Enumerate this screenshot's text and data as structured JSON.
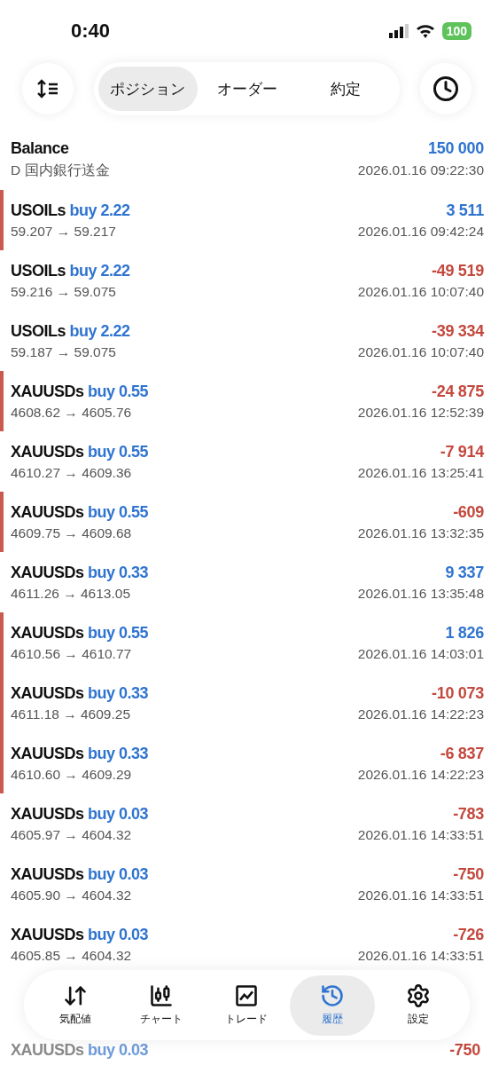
{
  "status_bar": {
    "time": "0:40",
    "battery": "100"
  },
  "segments": [
    {
      "label": "ポジション",
      "selected": true
    },
    {
      "label": "オーダー",
      "selected": false
    },
    {
      "label": "約定",
      "selected": false
    }
  ],
  "balance": {
    "title": "Balance",
    "amount": "150 000",
    "note": "D 国内銀行送金",
    "time": "2026.01.16 09:22:30"
  },
  "deals": [
    {
      "symbol": "USOILs",
      "side": "buy 2.22",
      "prices": "59.207 → 59.217",
      "profit": "3 511",
      "color": "#2f74d0",
      "time": "2026.01.16 09:42:24",
      "flagged": true
    },
    {
      "symbol": "USOILs",
      "side": "buy 2.22",
      "prices": "59.216 → 59.075",
      "profit": "-49 519",
      "color": "#c4483d",
      "time": "2026.01.16 10:07:40",
      "flagged": false
    },
    {
      "symbol": "USOILs",
      "side": "buy 2.22",
      "prices": "59.187 → 59.075",
      "profit": "-39 334",
      "color": "#c4483d",
      "time": "2026.01.16 10:07:40",
      "flagged": false
    },
    {
      "symbol": "XAUUSDs",
      "side": "buy 0.55",
      "prices": "4608.62 → 4605.76",
      "profit": "-24 875",
      "color": "#c4483d",
      "time": "2026.01.16 12:52:39",
      "flagged": true
    },
    {
      "symbol": "XAUUSDs",
      "side": "buy 0.55",
      "prices": "4610.27 → 4609.36",
      "profit": "-7 914",
      "color": "#c4483d",
      "time": "2026.01.16 13:25:41",
      "flagged": false
    },
    {
      "symbol": "XAUUSDs",
      "side": "buy 0.55",
      "prices": "4609.75 → 4609.68",
      "profit": "-609",
      "color": "#c4483d",
      "time": "2026.01.16 13:32:35",
      "flagged": true
    },
    {
      "symbol": "XAUUSDs",
      "side": "buy 0.33",
      "prices": "4611.26 → 4613.05",
      "profit": "9 337",
      "color": "#2f74d0",
      "time": "2026.01.16 13:35:48",
      "flagged": false
    },
    {
      "symbol": "XAUUSDs",
      "side": "buy 0.55",
      "prices": "4610.56 → 4610.77",
      "profit": "1 826",
      "color": "#2f74d0",
      "time": "2026.01.16 14:03:01",
      "flagged": true
    },
    {
      "symbol": "XAUUSDs",
      "side": "buy 0.33",
      "prices": "4611.18 → 4609.25",
      "profit": "-10 073",
      "color": "#c4483d",
      "time": "2026.01.16 14:22:23",
      "flagged": true
    },
    {
      "symbol": "XAUUSDs",
      "side": "buy 0.33",
      "prices": "4610.60 → 4609.29",
      "profit": "-6 837",
      "color": "#c4483d",
      "time": "2026.01.16 14:22:23",
      "flagged": true
    },
    {
      "symbol": "XAUUSDs",
      "side": "buy 0.03",
      "prices": "4605.97 → 4604.32",
      "profit": "-783",
      "color": "#c4483d",
      "time": "2026.01.16 14:33:51",
      "flagged": false
    },
    {
      "symbol": "XAUUSDs",
      "side": "buy 0.03",
      "prices": "4605.90 → 4604.32",
      "profit": "-750",
      "color": "#c4483d",
      "time": "2026.01.16 14:33:51",
      "flagged": false
    },
    {
      "symbol": "XAUUSDs",
      "side": "buy 0.03",
      "prices": "4605.85 → 4604.32",
      "profit": "-726",
      "color": "#c4483d",
      "time": "2026.01.16 14:33:51",
      "flagged": false
    }
  ],
  "last_deal": {
    "symbol": "XAUUSDs",
    "side": "buy 0.03",
    "profit": "-750",
    "color": "#c4483d"
  },
  "bottom_nav": [
    {
      "label": "気配値",
      "kind": "quotes",
      "selected": false
    },
    {
      "label": "チャート",
      "kind": "chart",
      "selected": false
    },
    {
      "label": "トレード",
      "kind": "trade",
      "selected": false
    },
    {
      "label": "履歴",
      "kind": "history",
      "selected": true
    },
    {
      "label": "設定",
      "kind": "settings",
      "selected": false
    }
  ]
}
